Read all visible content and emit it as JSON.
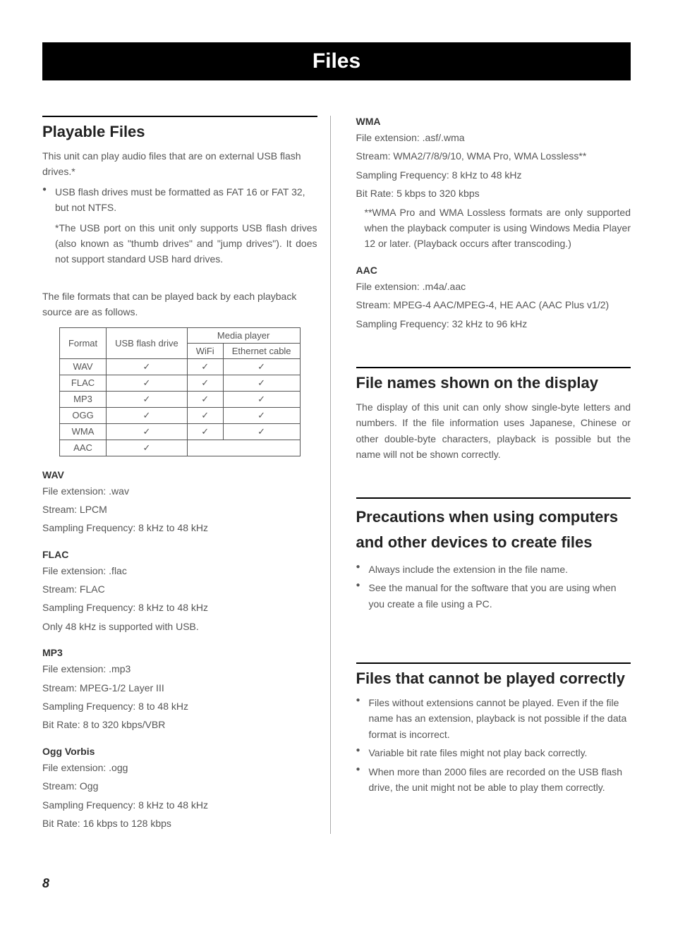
{
  "page": {
    "title_bar": "Files",
    "page_number": "8"
  },
  "left": {
    "playable_heading": "Playable Files",
    "playable_intro": "This unit can play audio files that are on external USB flash drives.*",
    "usb_bullet": "USB flash drives must be formatted as FAT 16 or FAT 32, but not NTFS.",
    "usb_footnote": "*The USB port on this unit only supports USB flash drives (also known as \"thumb drives\" and \"jump drives\"). It does not support standard USB hard drives.",
    "formats_intro": "The file formats that can be played back by each playback source are as follows.",
    "table": {
      "headers": {
        "format": "Format",
        "usb": "USB flash drive",
        "media": "Media player",
        "wifi": "WiFi",
        "eth": "Ethernet cable"
      },
      "rows": [
        {
          "fmt": "WAV",
          "usb": "✓",
          "wifi": "✓",
          "eth": "✓"
        },
        {
          "fmt": "FLAC",
          "usb": "✓",
          "wifi": "✓",
          "eth": "✓"
        },
        {
          "fmt": "MP3",
          "usb": "✓",
          "wifi": "✓",
          "eth": "✓"
        },
        {
          "fmt": "OGG",
          "usb": "✓",
          "wifi": "✓",
          "eth": "✓"
        },
        {
          "fmt": "WMA",
          "usb": "✓",
          "wifi": "✓",
          "eth": "✓"
        },
        {
          "fmt": "AAC",
          "usb": "✓",
          "wifi": "",
          "eth": ""
        }
      ]
    },
    "wav": {
      "title": "WAV",
      "l1": "File extension: .wav",
      "l2": "Stream: LPCM",
      "l3": "Sampling Frequency: 8 kHz to 48 kHz"
    },
    "flac": {
      "title": "FLAC",
      "l1": "File extension: .flac",
      "l2": "Stream: FLAC",
      "l3": "Sampling Frequency: 8 kHz to 48 kHz",
      "l4": "Only 48 kHz is supported with USB."
    },
    "mp3": {
      "title": "MP3",
      "l1": "File extension: .mp3",
      "l2": "Stream: MPEG-1/2 Layer III",
      "l3": "Sampling Frequency: 8 to 48 kHz",
      "l4": "Bit Rate: 8 to 320 kbps/VBR"
    },
    "ogg": {
      "title": "Ogg Vorbis",
      "l1": "File extension: .ogg",
      "l2": "Stream: Ogg",
      "l3": "Sampling Frequency: 8 kHz to 48 kHz",
      "l4": "Bit Rate: 16 kbps to 128 kbps"
    }
  },
  "right": {
    "wma": {
      "title": "WMA",
      "l1": "File extension: .asf/.wma",
      "l2": "Stream: WMA2/7/8/9/10, WMA Pro, WMA Lossless**",
      "l3": "Sampling Frequency: 8 kHz to 48 kHz",
      "l4": "Bit Rate: 5 kbps to 320 kbps",
      "note": "**WMA Pro and WMA Lossless formats are only supported when the playback computer is using Windows Media Player 12 or later. (Playback occurs after transcoding.)"
    },
    "aac": {
      "title": "AAC",
      "l1": "File extension: .m4a/.aac",
      "l2": "Stream: MPEG-4 AAC/MPEG-4, HE AAC (AAC Plus v1/2)",
      "l3": "Sampling Frequency: 32 kHz to 96 kHz"
    },
    "filenames": {
      "heading": "File names shown on the display",
      "body": "The display of this unit can only show single-byte letters and numbers. If the file information uses Japanese, Chinese or other double-byte characters, playback is possible but the name will not be shown correctly."
    },
    "precautions": {
      "heading_l1": "Precautions when using computers",
      "heading_l2": "and other devices to create files",
      "b1": "Always include the extension in the file name.",
      "b2": "See the manual for the software that you are using when you create a file using a PC."
    },
    "cannot": {
      "heading": "Files that cannot be played correctly",
      "b1": "Files without extensions cannot be played. Even if the file name has an extension, playback is not possible if the data format is incorrect.",
      "b2": "Variable bit rate files might not play back correctly.",
      "b3": "When more than 2000 files are recorded on the USB flash drive, the unit might not be able to play them correctly."
    }
  }
}
